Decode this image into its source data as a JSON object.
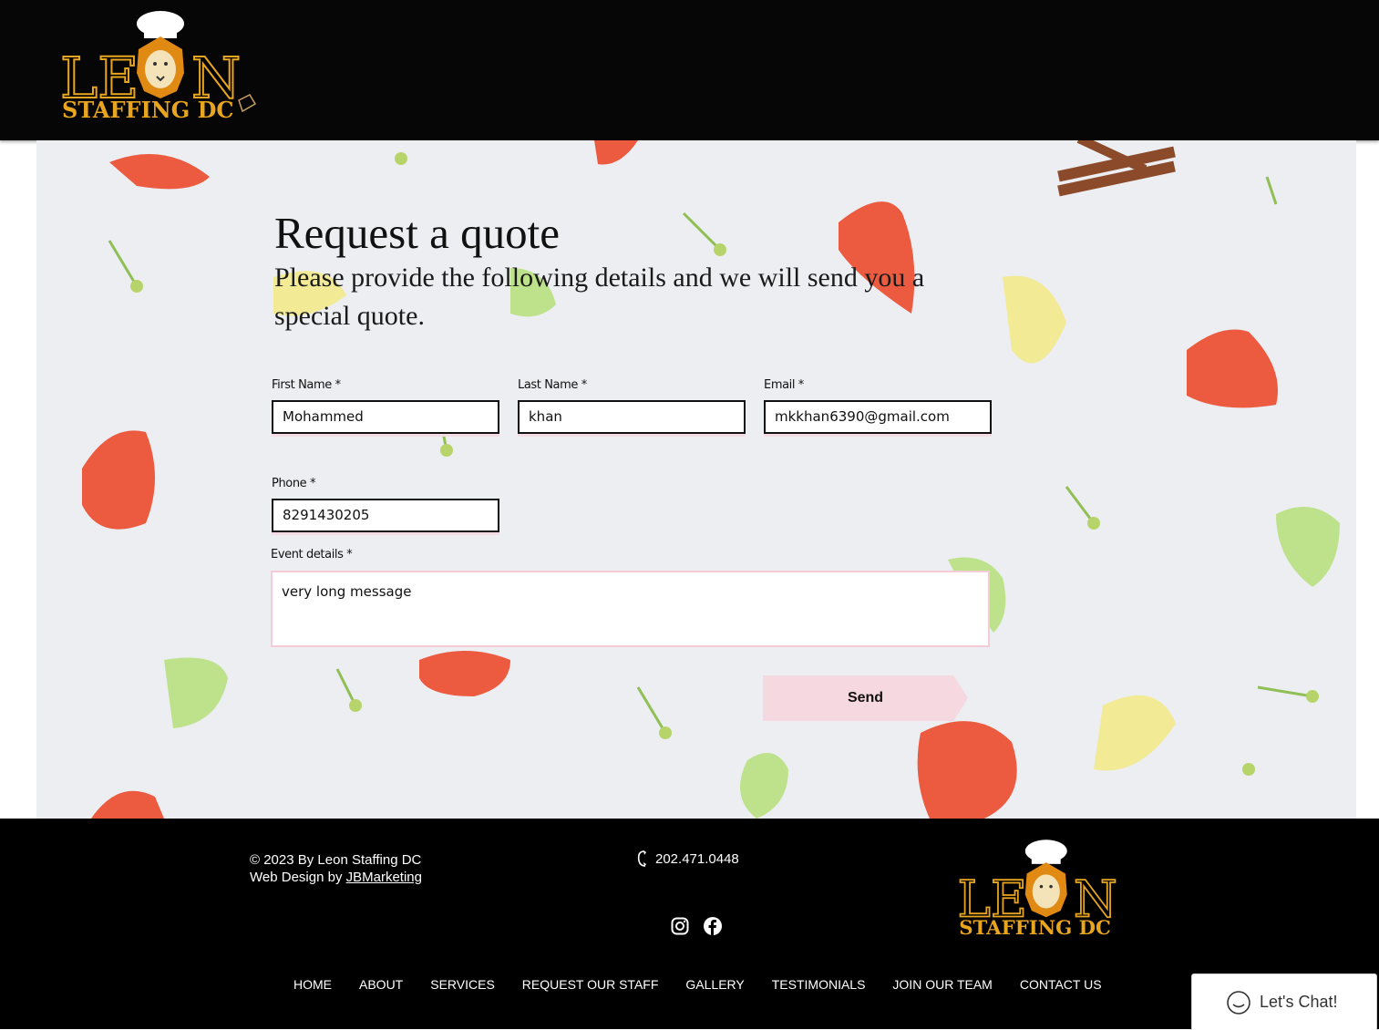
{
  "brand": {
    "logo_word": "LEON",
    "logo_sub": "STAFFING DC"
  },
  "form": {
    "title": "Request a quote",
    "subtitle": "Please provide the following details and we will send you a special quote.",
    "fields": {
      "first_name": {
        "label": "First Name *",
        "value": "Mohammed"
      },
      "last_name": {
        "label": "Last Name *",
        "value": "khan"
      },
      "email": {
        "label": "Email *",
        "value": "mkkhan6390@gmail.com"
      },
      "phone": {
        "label": "Phone *",
        "value": "8291430205"
      },
      "event_details": {
        "label": "Event details *",
        "value": "very long message"
      }
    },
    "send_label": "Send"
  },
  "footer": {
    "copyright": "© 2023 By Leon Staffing DC",
    "credit_prefix": "Web Design by ",
    "credit_link": "JBMarketing ",
    "phone": "202.471.0448",
    "social_icons": [
      "instagram-icon",
      "facebook-icon"
    ],
    "nav": [
      "HOME",
      "ABOUT",
      "SERVICES",
      "REQUEST OUR STAFF",
      "GALLERY",
      "TESTIMONIALS",
      "JOIN OUR TEAM",
      "CONTACT US"
    ]
  },
  "chat": {
    "label": "Let's Chat!"
  },
  "colors": {
    "gold": "#e8a520",
    "pink": "#f6d8e1",
    "black": "#000000",
    "strawberry": "#ec5a3f",
    "lemon": "#f2ea95",
    "lime": "#bde28b"
  }
}
